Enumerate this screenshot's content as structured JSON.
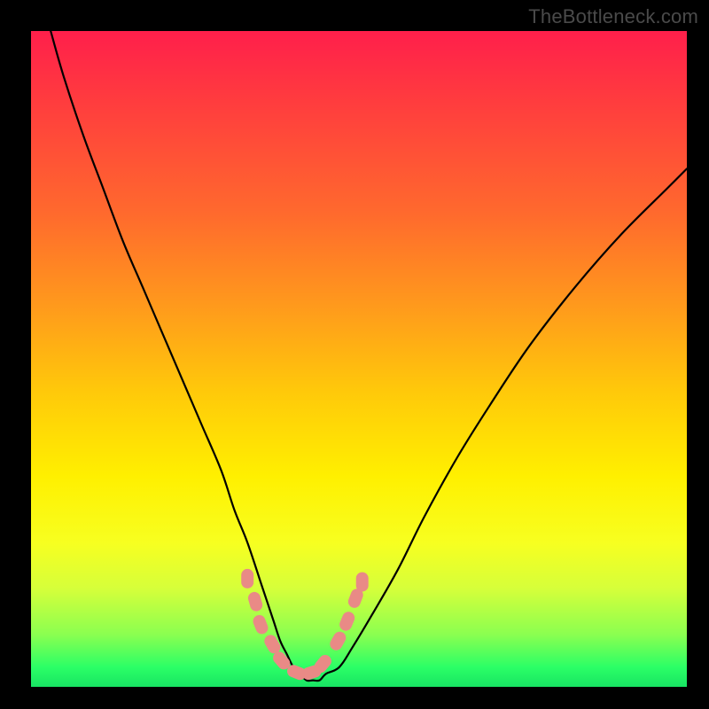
{
  "watermark": "TheBottleneck.com",
  "chart_data": {
    "type": "line",
    "title": "",
    "xlabel": "",
    "ylabel": "",
    "xlim": [
      0,
      100
    ],
    "ylim": [
      0,
      100
    ],
    "grid": false,
    "legend": false,
    "series": [
      {
        "name": "bottleneck-curve",
        "color": "#000000",
        "x": [
          3,
          5,
          8,
          11,
          14,
          17,
          20,
          23,
          26,
          29,
          31,
          33,
          35,
          36,
          37,
          38,
          39,
          40,
          41,
          42,
          43,
          44,
          45,
          47,
          49,
          52,
          56,
          60,
          65,
          70,
          76,
          83,
          90,
          97,
          100
        ],
        "y": [
          100,
          93,
          84,
          76,
          68,
          61,
          54,
          47,
          40,
          33,
          27,
          22,
          16,
          13,
          10,
          7,
          5,
          3,
          2,
          1,
          1,
          1,
          2,
          3,
          6,
          11,
          18,
          26,
          35,
          43,
          52,
          61,
          69,
          76,
          79
        ]
      },
      {
        "name": "bottom-markers",
        "color": "#e98a86",
        "marker": "round",
        "x": [
          33.0,
          34.2,
          35.0,
          36.8,
          38.2,
          40.5,
          42.8,
          44.5,
          46.8,
          48.2,
          49.5,
          50.5
        ],
        "y": [
          16.5,
          13.0,
          9.5,
          6.5,
          4.0,
          2.2,
          2.2,
          3.5,
          7.0,
          10.0,
          13.5,
          16.0
        ]
      }
    ],
    "background_gradient": {
      "direction": "vertical",
      "stops": [
        {
          "pos": 0.0,
          "color": "#ff1f4b"
        },
        {
          "pos": 0.28,
          "color": "#ff6a2d"
        },
        {
          "pos": 0.55,
          "color": "#ffc90a"
        },
        {
          "pos": 0.78,
          "color": "#f7ff20"
        },
        {
          "pos": 0.92,
          "color": "#8bff50"
        },
        {
          "pos": 1.0,
          "color": "#18e463"
        }
      ]
    }
  }
}
